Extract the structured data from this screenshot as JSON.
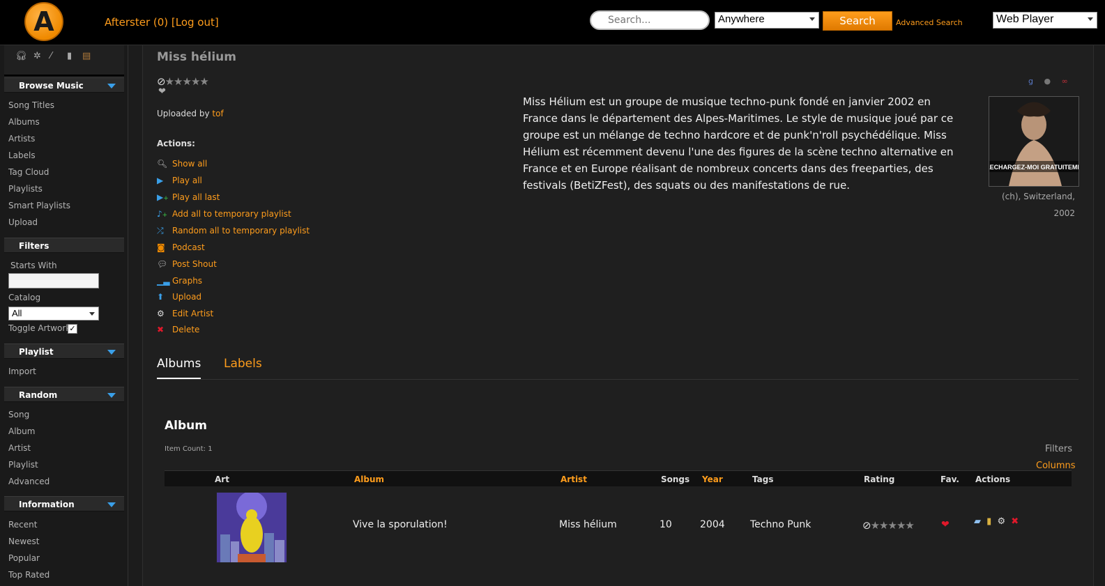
{
  "header": {
    "user_text": "Afterster (0) [Log out]",
    "search_placeholder": "Search...",
    "search_scope": "Anywhere",
    "search_button": "Search",
    "advanced_search": "Advanced Search",
    "player_select": "Web Player"
  },
  "sidebar": {
    "browse_music": {
      "header": "Browse Music",
      "items": [
        "Song Titles",
        "Albums",
        "Artists",
        "Labels",
        "Tag Cloud",
        "Playlists",
        "Smart Playlists",
        "Upload"
      ]
    },
    "filters": {
      "header": "Filters",
      "starts_with": "Starts With",
      "catalog_label": "Catalog",
      "catalog_value": "All",
      "toggle_artwork": "Toggle Artwork"
    },
    "playlist": {
      "header": "Playlist",
      "items": [
        "Import"
      ]
    },
    "random": {
      "header": "Random",
      "items": [
        "Song",
        "Album",
        "Artist",
        "Playlist",
        "Advanced"
      ]
    },
    "information": {
      "header": "Information",
      "items": [
        "Recent",
        "Newest",
        "Popular",
        "Top Rated"
      ]
    }
  },
  "artist": {
    "name": "Miss hélium",
    "rating_stars": 0,
    "uploaded_by_prefix": "Uploaded by",
    "uploaded_by_user": "tof",
    "actions_label": "Actions:",
    "actions": [
      "Show all",
      "Play all",
      "Play all last",
      "Add all to temporary playlist",
      "Random all to temporary playlist",
      "Podcast",
      "Post Shout",
      "Graphs",
      "Upload",
      "Edit Artist",
      "Delete"
    ],
    "bio": "Miss Hélium est un groupe de musique techno-punk fondé en janvier 2002 en France dans le département des Alpes-Maritimes. Le style de musique joué par ce groupe est un mélange de techno hardcore et de punk'n'roll psychédélique. Miss Hélium est récemment devenu l'une des figures de la scène techno alternative en France et en Europe réalisant de nombreux concerts dans des freeparties, des festivals (BetiZFest), des squats ou des manifestations de rue.",
    "photo_text": "TELECHARGEZ-MOI GRATUITEMENT",
    "photo_caption": "(ch), Switzerland, 2002"
  },
  "tabs": [
    "Albums",
    "Labels"
  ],
  "album_section": {
    "heading": "Album",
    "item_count": "Item Count: 1",
    "filters": "Filters",
    "columns": "Columns",
    "headers": {
      "art": "Art",
      "album": "Album",
      "artist": "Artist",
      "songs": "Songs",
      "year": "Year",
      "tags": "Tags",
      "rating": "Rating",
      "fav": "Fav.",
      "actions": "Actions"
    },
    "rows": [
      {
        "album": "Vive la sporulation!",
        "artist": "Miss hélium",
        "songs": "10",
        "year": "2004",
        "tags": "Techno Punk",
        "rating_stars": 0,
        "favorite": true
      }
    ]
  }
}
